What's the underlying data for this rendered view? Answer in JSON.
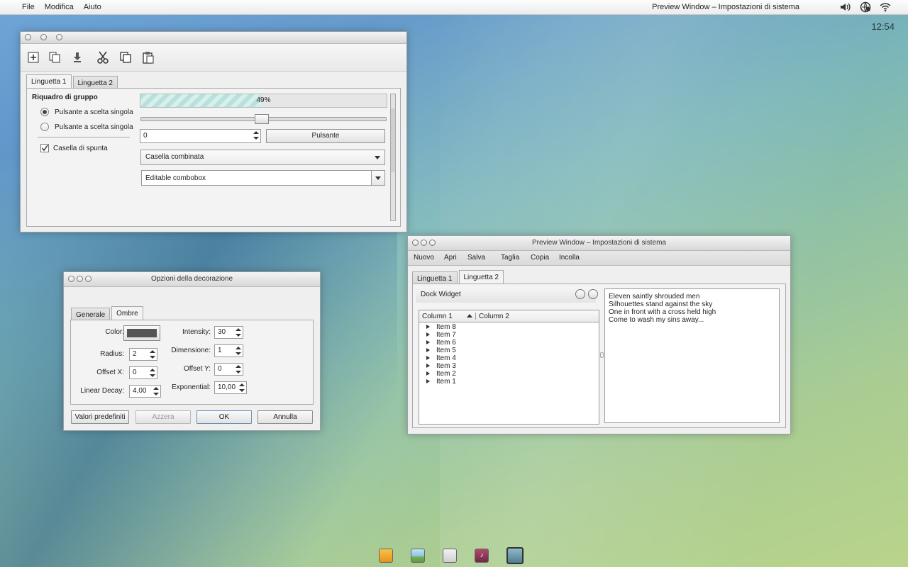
{
  "topbar": {
    "menus": [
      "File",
      "Modifica",
      "Aiuto"
    ],
    "window_title": "Preview Window – Impostazioni di sistema",
    "clock": "12:54",
    "tray_icons": [
      "volume-icon",
      "network-globe-icon",
      "wifi-icon"
    ]
  },
  "win1": {
    "toolbar_icons": [
      "new-icon",
      "copy-pages-icon",
      "download-icon",
      "cut-icon",
      "copy-icon",
      "paste-icon"
    ],
    "tabs": [
      "Linguetta 1",
      "Linguetta 2"
    ],
    "group_title": "Riquadro di gruppo",
    "radio1": "Pulsante a scelta singola",
    "radio2": "Pulsante a scelta singola",
    "checkbox": "Casella di spunta",
    "progress_label": "49%",
    "progress": 0.49,
    "slider_level": 0.49,
    "spin_value": "0",
    "button": "Pulsante",
    "combo": "Casella combinata",
    "editable_combo": "Editable combobox"
  },
  "win2": {
    "title": "Opzioni della decorazione",
    "tabs": [
      "Generale",
      "Ombre"
    ],
    "color_label": "Color:",
    "color_value": "#555555",
    "radius_label": "Radius:",
    "radius_value": "2",
    "offsetx_label": "Offset X:",
    "offsetx_value": "0",
    "linear_label": "Linear Decay:",
    "linear_value": "4,00",
    "intensity_label": "Intensity:",
    "intensity_value": "30",
    "dimensione_label": "Dimensione:",
    "dimensione_value": "1",
    "offsety_label": "Offset Y:",
    "offsety_value": "0",
    "exponential_label": "Exponential:",
    "exponential_value": "10,00",
    "btn_defaults": "Valori predefiniti",
    "btn_reset": "Azzera",
    "btn_ok": "OK",
    "btn_cancel": "Annulla"
  },
  "win3": {
    "title": "Preview Window – Impostazioni di sistema",
    "menu": [
      "Nuovo",
      "Apri",
      "Salva",
      "Taglia",
      "Copia",
      "Incolla"
    ],
    "tabs": [
      "Linguetta 1",
      "Linguetta 2"
    ],
    "dock_title": "Dock Widget",
    "col1": "Column 1",
    "col2": "Column 2",
    "items": [
      "Item 8",
      "Item 7",
      "Item 6",
      "Item 5",
      "Item 4",
      "Item 3",
      "Item 2",
      "Item 1"
    ],
    "text_lines": [
      "Eleven saintly shrouded men",
      "Silhouettes stand against the sky",
      "One in front with a cross held high",
      "Come to wash my sins away..."
    ]
  },
  "dock": {
    "icons": [
      "folder-icon",
      "image-viewer-icon",
      "blank-app-icon",
      "music-icon",
      "settings-icon"
    ]
  }
}
